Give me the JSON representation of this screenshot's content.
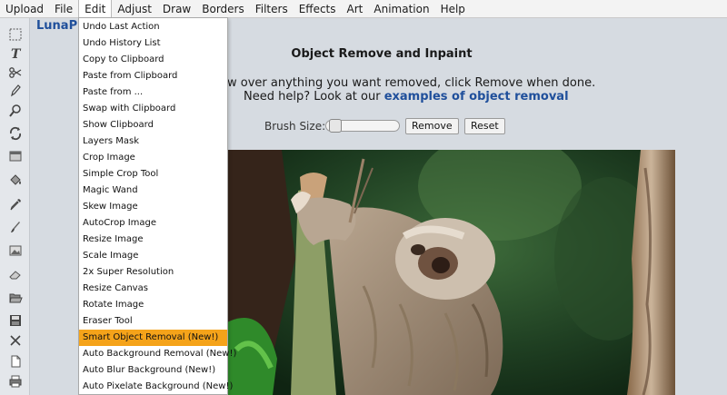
{
  "menubar": {
    "items": [
      "Upload",
      "File",
      "Edit",
      "Adjust",
      "Draw",
      "Borders",
      "Filters",
      "Effects",
      "Art",
      "Animation",
      "Help"
    ],
    "active": "Edit"
  },
  "brand": "LunaPic",
  "panel": {
    "title": "Object Remove and Inpaint",
    "instruction_line1": "w over anything you want removed, click Remove when done.",
    "help_prefix": "Need help? Look at our ",
    "help_link": "examples of object removal",
    "brush_label": "Brush Size:",
    "brush_size": 0.05,
    "remove_label": "Remove",
    "reset_label": "Reset"
  },
  "edit_menu": {
    "items": [
      "Undo Last Action",
      "Undo History List",
      "Copy to Clipboard",
      "Paste from Clipboard",
      "Paste from ...",
      "Swap with Clipboard",
      "Show Clipboard",
      "Layers Mask",
      "Crop Image",
      "Simple Crop Tool",
      "Magic Wand",
      "Skew Image",
      "AutoCrop Image",
      "Resize Image",
      "Scale Image",
      "2x Super Resolution",
      "Resize Canvas",
      "Rotate Image",
      "Eraser Tool",
      "Smart Object Removal (New!)",
      "Auto Background Removal (New!)",
      "Auto Blur Background (New!)",
      "Auto Pixelate Background (New!)"
    ],
    "highlighted_index": 19
  },
  "toolbar": {
    "tools": [
      "select-icon",
      "text-icon",
      "scissors-icon",
      "pencil-icon",
      "zoom-icon",
      "rotate-icon",
      "layers-icon",
      "paint-bucket-icon",
      "eyedropper-icon",
      "brush-icon",
      "image-icon",
      "eraser-icon",
      "open-folder-icon",
      "save-icon",
      "close-icon",
      "new-file-icon",
      "print-icon"
    ]
  },
  "colors": {
    "accent_highlight": "#f5a31a",
    "link": "#1f4f9b",
    "background": "#d6dbe1"
  }
}
